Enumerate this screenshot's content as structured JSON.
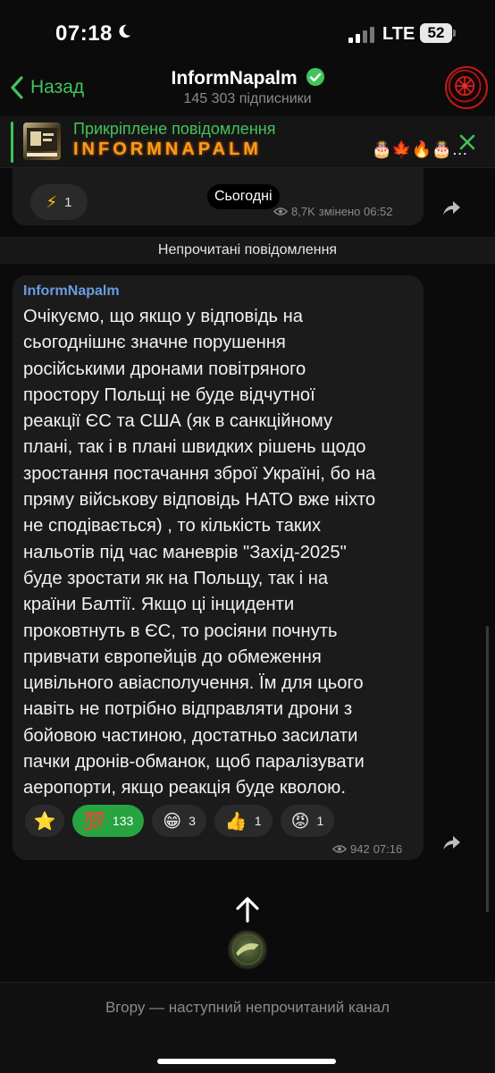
{
  "status_bar": {
    "time": "07:18",
    "network": "LTE",
    "battery": "52"
  },
  "header": {
    "back_label": "Назад",
    "channel_name": "InformNapalm",
    "subscribers": "145 303 підписники"
  },
  "pinned": {
    "label": "Прикріплене повідомлення",
    "text": "INFORMNAPALM",
    "emoji": "🎂🍁🔥🎂…"
  },
  "previous_message": {
    "reaction_emoji": "⚡",
    "reaction_count": "1",
    "views": "8,7K",
    "edited_time": "змінено 06:52"
  },
  "date_badge": "Сьогодні",
  "unread_divider": "Непрочитані повідомлення",
  "message": {
    "sender": "InformNapalm",
    "lines": [
      "Очікуємо, що якщо у відповідь на",
      "сьогоднішнє значне порушення",
      "російськими дронами повітряного",
      "простору Польщі не буде відчутної",
      "реакції ЄС та США (як в санкційному",
      "плані, так і в плані швидких рішень щодо",
      "зростання постачання зброї Україні, бо на",
      "пряму військову відповідь НАТО вже ніхто",
      "не сподівається) , то кількість таких",
      "нальотів під час маневрів \"Захід-2025\"",
      "буде зростати як на Польщу, так і на",
      "країни Балтії. Якщо ці інциденти",
      "проковтнуть в ЄС, то росіяни почнуть",
      "привчати європейців до обмеження",
      "цивільного авіасполучення. Їм для цього",
      "навіть не потрібно відправляти дрони з",
      "бойовою частиною, достатньо засилати",
      "пачки дронів-обманок, щоб паралізувати",
      "аеропорти, якщо реакція буде кволою."
    ],
    "reactions": [
      {
        "emoji": "⭐",
        "count": ""
      },
      {
        "emoji": "💯",
        "count": "133"
      },
      {
        "emoji": "😁",
        "count": "3"
      },
      {
        "emoji": "👍",
        "count": "1"
      },
      {
        "emoji": "😡",
        "count": "1"
      }
    ],
    "views": "942",
    "time": "07:16"
  },
  "bottom_hint": "Вгору — наступний непрочитаний канал",
  "colors": {
    "accent": "#43c35b",
    "link": "#6a9ce0",
    "active_reaction": "#27a33f"
  }
}
